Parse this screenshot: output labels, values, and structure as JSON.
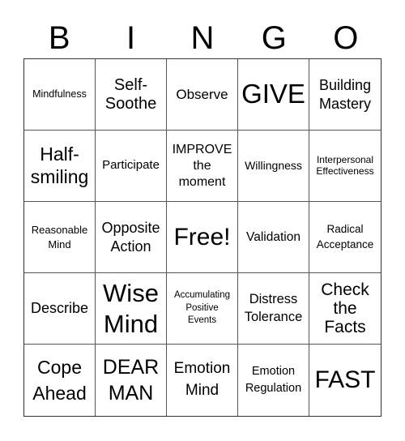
{
  "header": {
    "letters": [
      "B",
      "I",
      "N",
      "G",
      "O"
    ]
  },
  "board": {
    "cells": [
      "Mindfulness",
      "Self-\nSoothe",
      "Observe",
      "GIVE",
      "Building\nMastery",
      "Half-\nsmiling",
      "Participate",
      "IMPROVE\nthe\nmoment",
      "Willingness",
      "Interpersonal\nEffectiveness",
      "Reasonable\nMind",
      "Opposite\nAction",
      "Free!",
      "Validation",
      "Radical\nAcceptance",
      "Describe",
      "Wise\nMind",
      "Accumulating\nPositive\nEvents",
      "Distress\nTolerance",
      "Check\nthe\nFacts",
      "Cope\nAhead",
      "DEAR\nMAN",
      "Emotion\nMind",
      "Emotion\nRegulation",
      "FAST"
    ],
    "free_space_label": "Free!"
  }
}
